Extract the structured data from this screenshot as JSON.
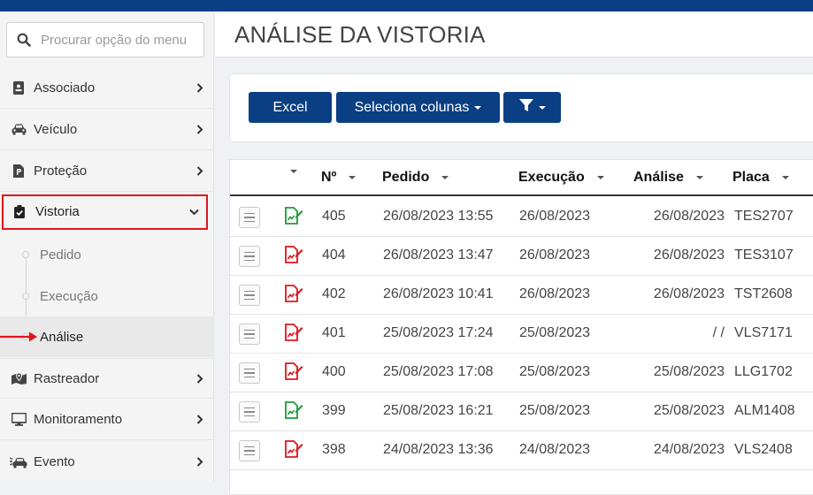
{
  "colors": {
    "brand": "#0b3f83",
    "highlight": "#e0141c",
    "status_green": "#1e9a3c",
    "status_red": "#e0141c"
  },
  "search": {
    "placeholder": "Procurar opção do menu",
    "icon": "search-icon"
  },
  "sidebar": {
    "items": [
      {
        "label": "Associado",
        "icon": "id-card-icon"
      },
      {
        "label": "Veículo",
        "icon": "car-icon"
      },
      {
        "label": "Proteção",
        "icon": "document-icon"
      },
      {
        "label": "Vistoria",
        "icon": "clipboard-check-icon",
        "expanded": true
      },
      {
        "label": "Rastreador",
        "icon": "map-marker-icon"
      },
      {
        "label": "Monitoramento",
        "icon": "monitor-icon"
      },
      {
        "label": "Evento",
        "icon": "car-crash-icon"
      }
    ],
    "subitems": [
      {
        "label": "Pedido"
      },
      {
        "label": "Execução"
      },
      {
        "label": "Análise",
        "selected": true
      }
    ]
  },
  "header": {
    "title": "ANÁLISE DA VISTORIA"
  },
  "toolbar": {
    "excel_label": "Excel",
    "columns_label": "Seleciona colunas",
    "filter_icon": "filter-icon"
  },
  "table": {
    "columns": [
      "Nº",
      "Pedido",
      "Execução",
      "Análise",
      "Placa"
    ],
    "rows": [
      {
        "status": "green",
        "n": "405",
        "pedido": "26/08/2023 13:55",
        "execucao": "26/08/2023",
        "analise": "26/08/2023",
        "placa": "TES2707"
      },
      {
        "status": "red",
        "n": "404",
        "pedido": "26/08/2023 13:47",
        "execucao": "26/08/2023",
        "analise": "26/08/2023",
        "placa": "TES3107"
      },
      {
        "status": "red",
        "n": "402",
        "pedido": "26/08/2023 10:41",
        "execucao": "26/08/2023",
        "analise": "26/08/2023",
        "placa": "TST2608"
      },
      {
        "status": "red",
        "n": "401",
        "pedido": "25/08/2023 17:24",
        "execucao": "25/08/2023",
        "analise": "/ /",
        "placa": "VLS7171"
      },
      {
        "status": "red",
        "n": "400",
        "pedido": "25/08/2023 17:08",
        "execucao": "25/08/2023",
        "analise": "25/08/2023",
        "placa": "LLG1702"
      },
      {
        "status": "green",
        "n": "399",
        "pedido": "25/08/2023 16:21",
        "execucao": "25/08/2023",
        "analise": "25/08/2023",
        "placa": "ALM1408"
      },
      {
        "status": "red",
        "n": "398",
        "pedido": "24/08/2023 13:36",
        "execucao": "24/08/2023",
        "analise": "24/08/2023",
        "placa": "VLS2408"
      }
    ]
  }
}
